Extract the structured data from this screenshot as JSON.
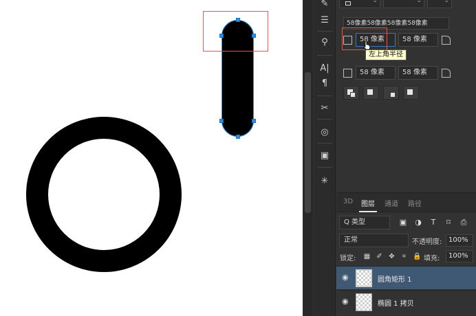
{
  "canvas": {
    "shapes": [
      "ellipse-ring",
      "rounded-rectangle-pill"
    ]
  },
  "properties": {
    "combined_radius": "58像素58像素58像素58像素",
    "radius_tl": "58 像素",
    "radius_tr": "58 像素",
    "radius_bl": "58 像素",
    "radius_br": "58 像素",
    "tooltip": "左上角半径"
  },
  "layers_panel": {
    "tabs": [
      "3D",
      "图层",
      "通道",
      "路径"
    ],
    "active_tab": "图层",
    "filter_label": "Q 类型",
    "blend_mode": "正常",
    "opacity_label": "不透明度:",
    "opacity_value": "100%",
    "lock_label": "锁定:",
    "fill_label": "填充:",
    "fill_value": "100%",
    "layers": [
      {
        "name": "圆角矩形 1",
        "selected": true
      },
      {
        "name": "椭圆 1 拷贝",
        "selected": false
      }
    ]
  },
  "colors": {
    "selection_blue": "#3b8cd6",
    "annotation_red": "#e05555",
    "panel_bg": "#323232",
    "selected_layer": "#3f5874"
  },
  "icons": [
    "pen-icon",
    "sliders-icon",
    "stamp-icon",
    "character-icon",
    "paragraph-icon",
    "tools-icon",
    "path-icon",
    "frame-icon",
    "brush-icon",
    "eye-icon",
    "lock-icon"
  ]
}
